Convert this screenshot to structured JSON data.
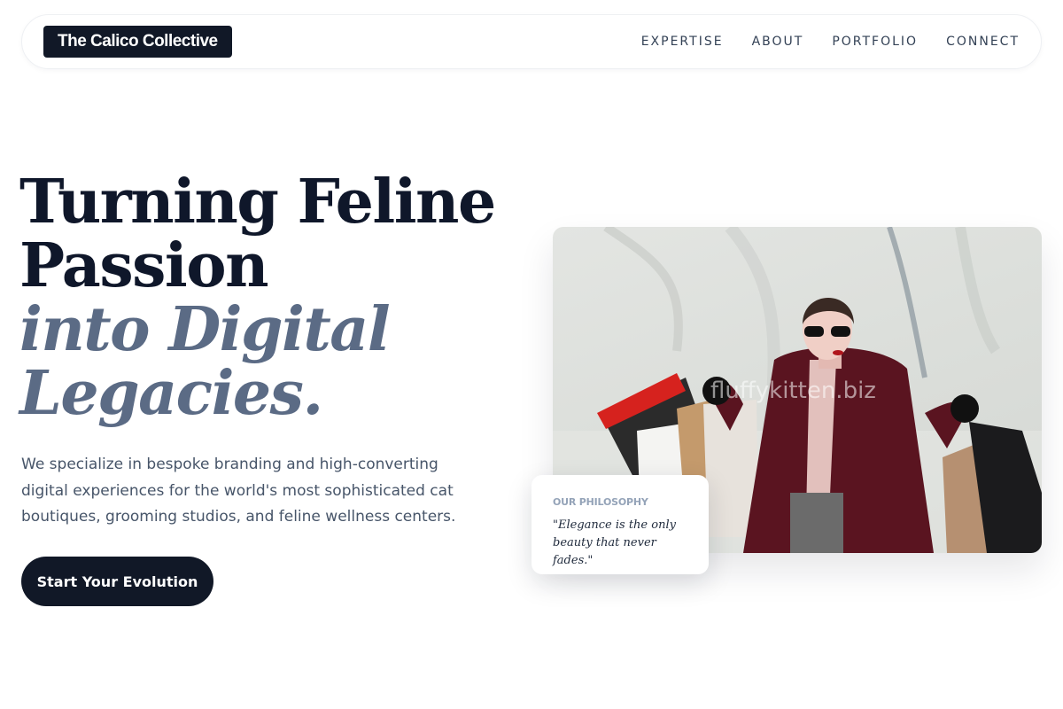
{
  "nav": {
    "logo": "The Calico Collective",
    "links": [
      "EXPERTISE",
      "ABOUT",
      "PORTFOLIO",
      "CONNECT"
    ]
  },
  "hero": {
    "title_line1": "Turning Feline",
    "title_line2": "Passion",
    "title_line3": "into Digital",
    "title_line4": "Legacies.",
    "description": "We specialize in bespoke branding and high-converting digital experiences for the world's most sophisticated cat boutiques, grooming studios, and feline wellness centers.",
    "cta_label": "Start Your Evolution",
    "image_watermark": "fluffykitten.biz"
  },
  "philosophy_card": {
    "label": "OUR PHILOSOPHY",
    "quote": "\"Elegance is the only beauty that never fades.\""
  },
  "colors": {
    "primary": "#111827",
    "accent_text": "#5b6b85",
    "body_text": "#475569"
  },
  "icons": {
    "hero_photo": "woman-with-shopping-bags-photo"
  }
}
